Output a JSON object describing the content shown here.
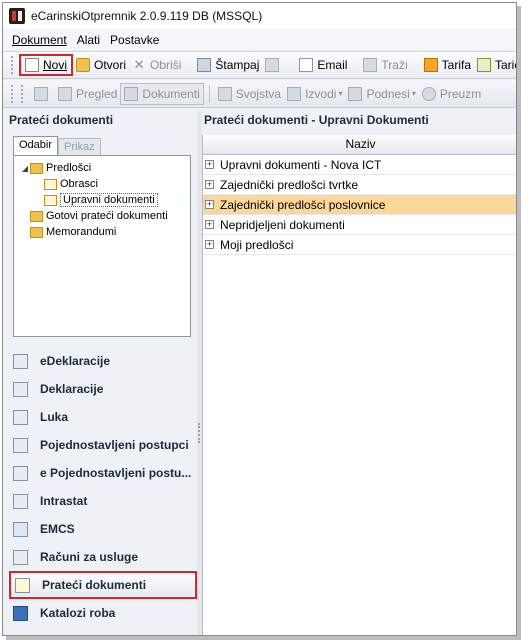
{
  "window": {
    "title": "eCarinskiOtpremnik 2.0.9.119 DB (MSSQL)"
  },
  "menu": {
    "items": [
      "Dokument",
      "Alati",
      "Postavke"
    ]
  },
  "toolbar1": {
    "new": "Novi",
    "open": "Otvori",
    "delete": "Obriši",
    "print": "Štampaj",
    "email": "Email",
    "search": "Traži",
    "tariff": "Tarifa",
    "taric": "Taric"
  },
  "toolbar2": {
    "preview": "Pregled",
    "documents": "Dokumenti",
    "properties": "Svojstva",
    "reports": "Izvodi",
    "submissions": "Podnesi",
    "download": "Preuzm"
  },
  "left": {
    "header": "Prateći dokumenti",
    "tabs": [
      "Odabir",
      "Prikaz"
    ],
    "tree": [
      "Predlošci",
      "Obrasci",
      "Upravni dokumenti",
      "Gotovi prateći dokumenti",
      "Memorandumi"
    ]
  },
  "nav": {
    "items": [
      "eDeklaracije",
      "Deklaracije",
      "Luka",
      "Pojednostavljeni postupci",
      "e Pojednostavljeni postu...",
      "Intrastat",
      "EMCS",
      "Računi za usluge",
      "Prateći dokumenti",
      "Katalozi roba"
    ]
  },
  "right": {
    "header": "Prateći dokumenti - Upravni Dokumenti",
    "column": "Naziv",
    "rows": [
      "Upravni dokumenti - Nova ICT",
      "Zajednički predlošci tvrtke",
      "Zajednički predlošci poslovnice",
      "Nepridjeljeni dokumenti",
      "Moji predlošci"
    ],
    "selected_row": 2
  },
  "colors": {
    "highlight": "#d3262b",
    "selection": "#fbd79a"
  }
}
